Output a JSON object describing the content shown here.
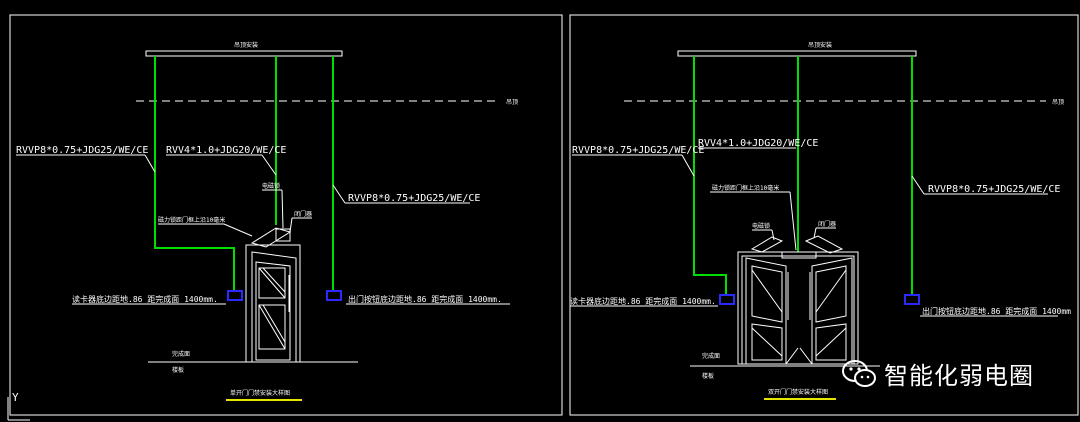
{
  "colors": {
    "background": "#000000",
    "line": "#ffffff",
    "cable": "#00dd00",
    "box": "#1a1aff",
    "title_underline": "#e6e600"
  },
  "left": {
    "ceiling_tag": "吊顶安装",
    "ceiling_side": "吊顶",
    "cable_left": "RVVP8*0.75+JDG25/WE/CE",
    "cable_mid": "RVV4*1.0+JDG20/WE/CE",
    "cable_right": "RVVP8*0.75+JDG25/WE/CE",
    "lock_label": "电磁锁",
    "bracket_label": "磁力锁距门框上沿10毫米",
    "door_close_label": "闭门器",
    "reader_left": "读卡器底边距地.86 距完成面 1400mm.",
    "reader_right": "出门按钮底边距地.86 距完成面 1400mm.",
    "floor_top": "完成面",
    "floor_bottom": "楼板",
    "title": "单开门门禁安装大样图"
  },
  "right": {
    "ceiling_tag": "吊顶安装",
    "ceiling_side": "吊顶",
    "cable_left": "RVVP8*0.75+JDG25/WE/CE",
    "cable_mid": "RVV4*1.0+JDG20/WE/CE",
    "cable_right": "RVVP8*0.75+JDG25/WE/CE",
    "bracket_label": "磁力锁距门框上沿10毫米",
    "lock_label_l": "电磁锁",
    "lock_label_r": "闭门器",
    "reader_left": "读卡器底边距地.86 距完成面 1400mm.",
    "reader_right": "出门按钮底边距地.86 距完成面 1400mm",
    "floor_top": "完成面",
    "floor_bottom": "楼板",
    "title": "双开门门禁安装大样图"
  },
  "ucs_label": "Y",
  "watermark": {
    "icon": "wechat-icon",
    "text": "智能化弱电圈"
  }
}
